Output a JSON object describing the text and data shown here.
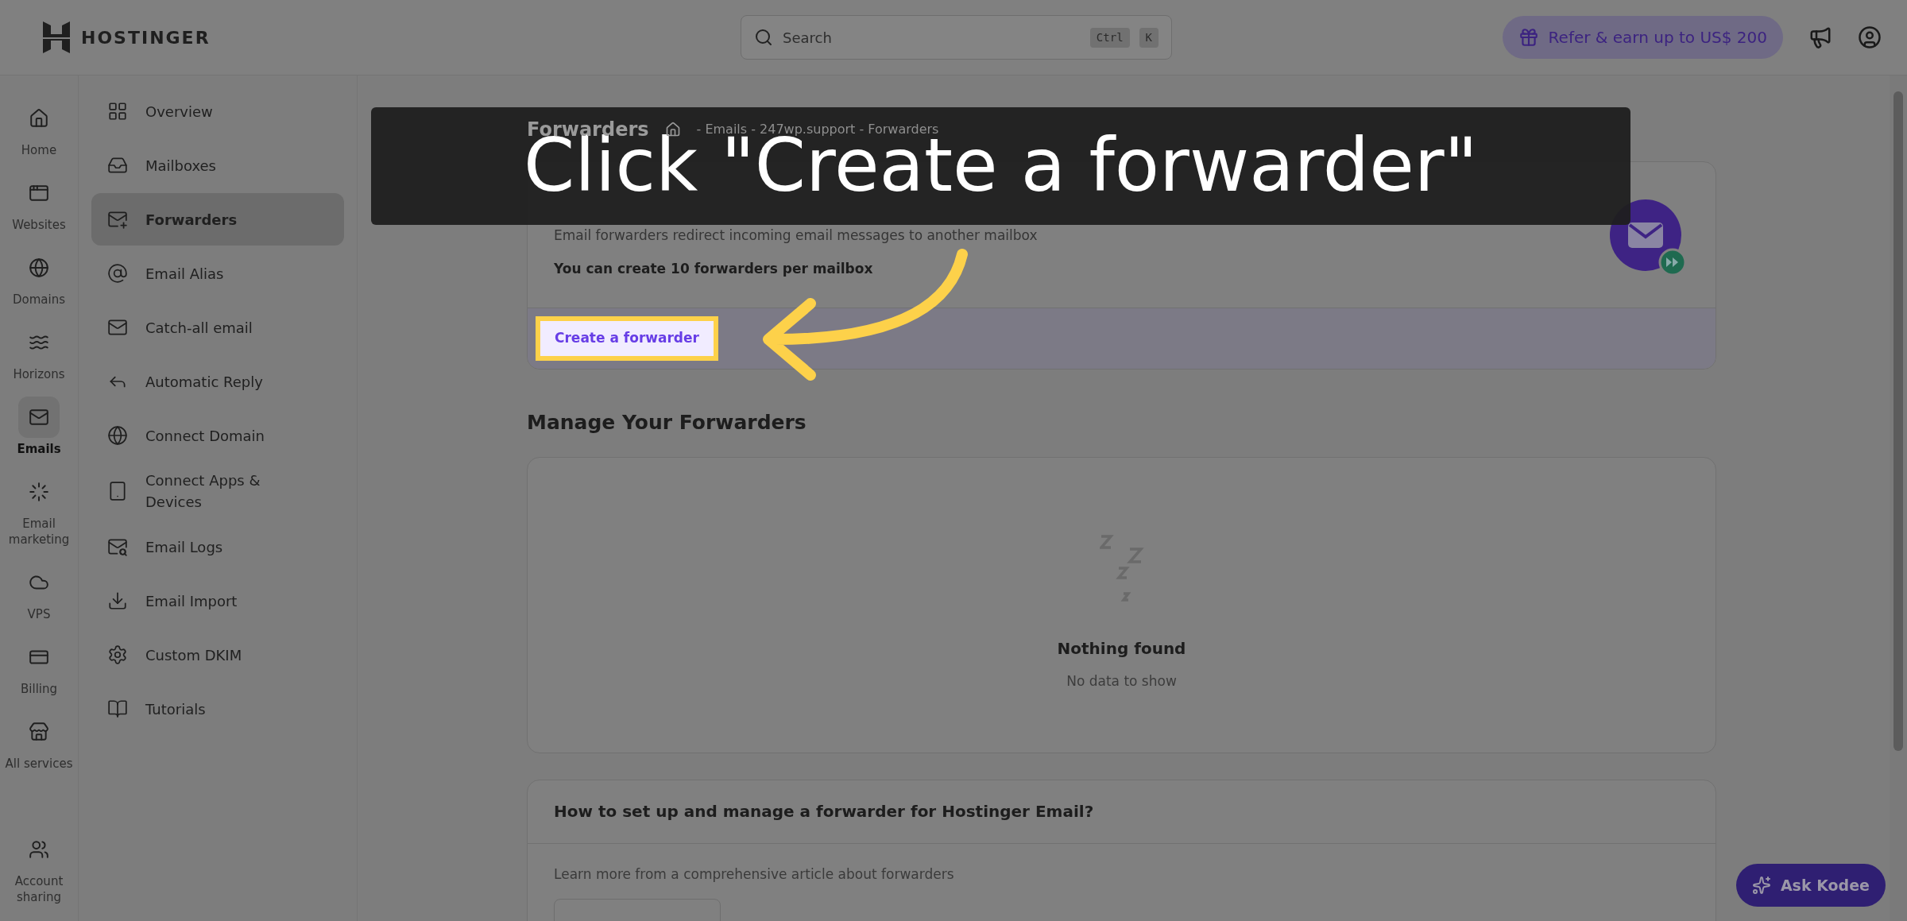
{
  "header": {
    "logo": "HOSTINGER",
    "search": {
      "placeholder": "Search",
      "keys": [
        "Ctrl",
        "K"
      ]
    },
    "refer": "Refer & earn up to US$ 200"
  },
  "rail": [
    {
      "kind": "home",
      "label": "Home",
      "selected": false
    },
    {
      "kind": "websites",
      "label": "Websites",
      "selected": false
    },
    {
      "kind": "domains",
      "label": "Domains",
      "selected": false
    },
    {
      "kind": "horizons",
      "label": "Horizons",
      "selected": false
    },
    {
      "kind": "emails",
      "label": "Emails",
      "selected": true
    },
    {
      "kind": "marketing",
      "label": "Email marketing",
      "selected": false
    },
    {
      "kind": "vps",
      "label": "VPS",
      "selected": false
    },
    {
      "kind": "billing",
      "label": "Billing",
      "selected": false
    },
    {
      "kind": "services",
      "label": "All services",
      "selected": false
    }
  ],
  "rail_bottom": {
    "kind": "sharing",
    "label": "Account sharing",
    "selected": false
  },
  "submenu": [
    {
      "kind": "overview",
      "label": "Overview",
      "selected": false
    },
    {
      "kind": "mailboxes",
      "label": "Mailboxes",
      "selected": false
    },
    {
      "kind": "forwarders",
      "label": "Forwarders",
      "selected": true
    },
    {
      "kind": "alias",
      "label": "Email Alias",
      "selected": false
    },
    {
      "kind": "catchall",
      "label": "Catch-all email",
      "selected": false
    },
    {
      "kind": "reply",
      "label": "Automatic Reply",
      "selected": false
    },
    {
      "kind": "domain",
      "label": "Connect Domain",
      "selected": false
    },
    {
      "kind": "apps",
      "label": "Connect Apps & Devices",
      "selected": false
    },
    {
      "kind": "logs",
      "label": "Email Logs",
      "selected": false
    },
    {
      "kind": "import",
      "label": "Email Import",
      "selected": false
    },
    {
      "kind": "dkim",
      "label": "Custom DKIM",
      "selected": false
    },
    {
      "kind": "tutorials",
      "label": "Tutorials",
      "selected": false
    }
  ],
  "page": {
    "title": "Forwarders",
    "breadcrumb": "- Emails - 247wp.support - Forwarders"
  },
  "create_card": {
    "description": "Email forwarders redirect incoming email messages to another mailbox",
    "limit": "You can create 10 forwarders per mailbox",
    "button": "Create a forwarder"
  },
  "manage": {
    "title": "Manage Your Forwarders",
    "empty_title": "Nothing found",
    "empty_text": "No data to show"
  },
  "help": {
    "title": "How to set up and manage a forwarder for Hostinger Email?",
    "text": "Learn more from a comprehensive article about forwarders"
  },
  "assistant": "Ask Kodee",
  "caption": "Click \"Create a forwarder\""
}
